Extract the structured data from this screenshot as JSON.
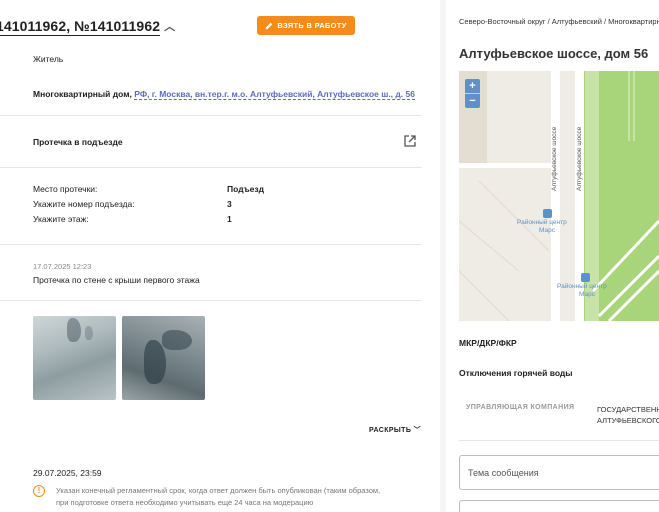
{
  "header": {
    "title": "141011962, №141011962",
    "take_button": "ВЗЯТЬ В РАБОТУ"
  },
  "author": {
    "role": "Житель"
  },
  "address": {
    "type_label": "Многоквартирный дом,",
    "link": "РФ, г. Москва, вн.тер.г. м.о. Алтуфьевский, Алтуфьевское ш., д. 56"
  },
  "category": {
    "title": "Протечка в подъезде"
  },
  "details": [
    {
      "label": "Место протечки:",
      "value": "Подъезд"
    },
    {
      "label": "Укажите номер подъезда:",
      "value": "3"
    },
    {
      "label": "Укажите этаж:",
      "value": "1"
    }
  ],
  "message": {
    "timestamp": "17.07.2025 12:23",
    "text": "Протечка по стене с крыши первого этажа"
  },
  "expand_label": "РАСКРЫТЬ",
  "deadline": {
    "timestamp": "29.07.2025, 23:59",
    "note": "Указан конечный регламентный срок, когда ответ должен быть опубликован (таким образом, при подготовке ответа необходимо учитывать еще 24 часа на модерацию"
  },
  "side": {
    "breadcrumb": "Северо-Восточный округ / Алтуфьевский / Многоквартирный дом",
    "title": "Алтуфьевское шоссе, дом 56",
    "map": {
      "zoom_in": "+",
      "zoom_out": "−",
      "street1": "Алтуфьевское шоссе",
      "street2": "Алтуфьевское шоссе",
      "poi1": "Районный центр",
      "poi1_sub": "Марс",
      "poi2": "Районный центр",
      "poi2_sub": "Марс"
    },
    "section1": "МКР/ДКР/ФКР",
    "section2": "Отключения горячей воды",
    "table": {
      "col_header": "УПРАВЛЯЮЩАЯ КОМПАНИЯ",
      "col_value_line1": "ГОСУДАРСТВЕННОЕ",
      "col_value_line2": "АЛТУФЬЕВСКОГО"
    },
    "subject_placeholder": "Тема сообщения"
  },
  "colors": {
    "accent": "#f58b1a",
    "link": "#5c6bc0",
    "map_green": "#a8d47a"
  }
}
